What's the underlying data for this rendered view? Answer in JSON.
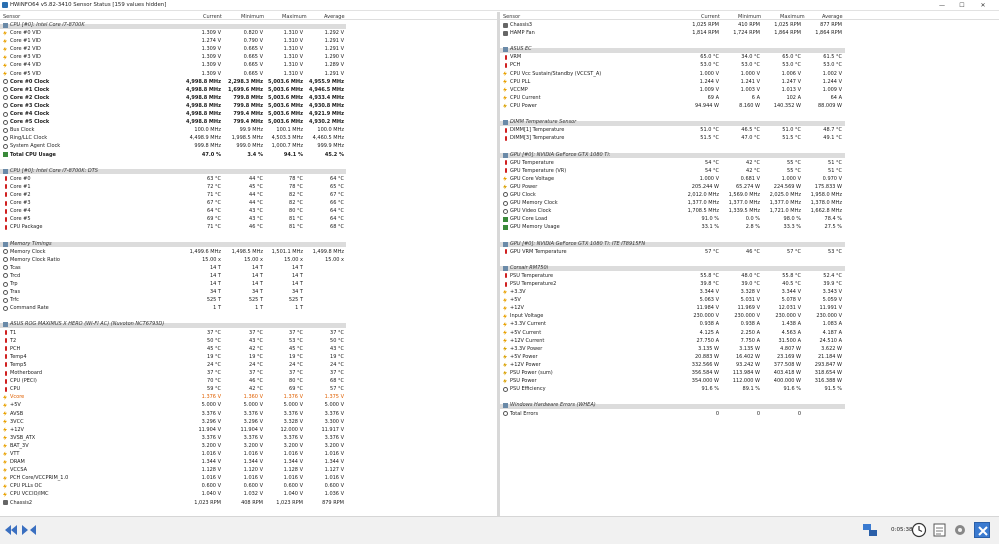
{
  "window": {
    "title": "HWiNFO64 v5.82-3410 Sensor Status [159 values hidden]",
    "minimize": "—",
    "maximize": "☐",
    "close": "✕"
  },
  "headers": {
    "sensor": "Sensor",
    "current": "Current",
    "minimum": "Minimum",
    "maximum": "Maximum",
    "average": "Average"
  },
  "left": [
    {
      "type": "group",
      "name": "CPU [#0]: Intel Core i7-8700K"
    },
    {
      "icon": "volt",
      "name": "Core #0 VID",
      "v": [
        "1.309 V",
        "0.820 V",
        "1.310 V",
        "1.292 V"
      ]
    },
    {
      "icon": "volt",
      "name": "Core #1 VID",
      "v": [
        "1.274 V",
        "0.790 V",
        "1.310 V",
        "1.291 V"
      ]
    },
    {
      "icon": "volt",
      "name": "Core #2 VID",
      "v": [
        "1.309 V",
        "0.665 V",
        "1.310 V",
        "1.291 V"
      ]
    },
    {
      "icon": "volt",
      "name": "Core #3 VID",
      "v": [
        "1.309 V",
        "0.665 V",
        "1.310 V",
        "1.290 V"
      ]
    },
    {
      "icon": "volt",
      "name": "Core #4 VID",
      "v": [
        "1.309 V",
        "0.665 V",
        "1.310 V",
        "1.289 V"
      ]
    },
    {
      "icon": "volt",
      "name": "Core #5 VID",
      "v": [
        "1.309 V",
        "0.665 V",
        "1.310 V",
        "1.291 V"
      ]
    },
    {
      "icon": "clock",
      "bold": true,
      "name": "Core #0 Clock",
      "v": [
        "4,998.8 MHz",
        "2,298.3 MHz",
        "5,003.6 MHz",
        "4,955.9 MHz"
      ]
    },
    {
      "icon": "clock",
      "bold": true,
      "name": "Core #1 Clock",
      "v": [
        "4,998.8 MHz",
        "1,699.6 MHz",
        "5,003.6 MHz",
        "4,946.5 MHz"
      ]
    },
    {
      "icon": "clock",
      "bold": true,
      "name": "Core #2 Clock",
      "v": [
        "4,998.8 MHz",
        "799.8 MHz",
        "5,003.6 MHz",
        "4,933.4 MHz"
      ]
    },
    {
      "icon": "clock",
      "bold": true,
      "name": "Core #3 Clock",
      "v": [
        "4,998.8 MHz",
        "799.8 MHz",
        "5,003.6 MHz",
        "4,930.8 MHz"
      ]
    },
    {
      "icon": "clock",
      "bold": true,
      "name": "Core #4 Clock",
      "v": [
        "4,998.8 MHz",
        "799.4 MHz",
        "5,003.6 MHz",
        "4,921.9 MHz"
      ]
    },
    {
      "icon": "clock",
      "bold": true,
      "name": "Core #5 Clock",
      "v": [
        "4,998.8 MHz",
        "799.4 MHz",
        "5,003.6 MHz",
        "4,930.2 MHz"
      ]
    },
    {
      "icon": "clock",
      "name": "Bus Clock",
      "v": [
        "100.0 MHz",
        "99.9 MHz",
        "100.1 MHz",
        "100.0 MHz"
      ]
    },
    {
      "icon": "clock",
      "name": "Ring/LLC Clock",
      "v": [
        "4,498.9 MHz",
        "1,998.5 MHz",
        "4,503.3 MHz",
        "4,460.5 MHz"
      ]
    },
    {
      "icon": "clock",
      "name": "System Agent Clock",
      "v": [
        "999.8 MHz",
        "999.0 MHz",
        "1,000.7 MHz",
        "999.9 MHz"
      ]
    },
    {
      "icon": "load",
      "bold": true,
      "name": "Total CPU Usage",
      "v": [
        "47.0 %",
        "3.4 %",
        "94.1 %",
        "45.2 %"
      ]
    },
    {
      "type": "gap"
    },
    {
      "type": "group",
      "name": "CPU [#0]: Intel Core i7-8700K: DTS"
    },
    {
      "icon": "temp",
      "name": "Core #0",
      "v": [
        "63 °C",
        "44 °C",
        "78 °C",
        "64 °C"
      ]
    },
    {
      "icon": "temp",
      "name": "Core #1",
      "v": [
        "72 °C",
        "45 °C",
        "78 °C",
        "65 °C"
      ]
    },
    {
      "icon": "temp",
      "name": "Core #2",
      "v": [
        "71 °C",
        "44 °C",
        "82 °C",
        "67 °C"
      ]
    },
    {
      "icon": "temp",
      "name": "Core #3",
      "v": [
        "67 °C",
        "44 °C",
        "82 °C",
        "66 °C"
      ]
    },
    {
      "icon": "temp",
      "name": "Core #4",
      "v": [
        "64 °C",
        "43 °C",
        "80 °C",
        "64 °C"
      ]
    },
    {
      "icon": "temp",
      "name": "Core #5",
      "v": [
        "69 °C",
        "43 °C",
        "81 °C",
        "64 °C"
      ]
    },
    {
      "icon": "temp",
      "name": "CPU Package",
      "v": [
        "71 °C",
        "46 °C",
        "81 °C",
        "68 °C"
      ]
    },
    {
      "type": "gap"
    },
    {
      "type": "group",
      "name": "Memory Timings"
    },
    {
      "icon": "clock",
      "name": "Memory Clock",
      "v": [
        "1,499.6 MHz",
        "1,498.5 MHz",
        "1,501.1 MHz",
        "1,499.8 MHz"
      ]
    },
    {
      "icon": "clock",
      "name": "Memory Clock Ratio",
      "v": [
        "15.00 x",
        "15.00 x",
        "15.00 x",
        "15.00 x"
      ]
    },
    {
      "icon": "clock",
      "name": "Tcas",
      "v": [
        "14 T",
        "14 T",
        "14 T",
        ""
      ]
    },
    {
      "icon": "clock",
      "name": "Trcd",
      "v": [
        "14 T",
        "14 T",
        "14 T",
        ""
      ]
    },
    {
      "icon": "clock",
      "name": "Trp",
      "v": [
        "14 T",
        "14 T",
        "14 T",
        ""
      ]
    },
    {
      "icon": "clock",
      "name": "Tras",
      "v": [
        "34 T",
        "34 T",
        "34 T",
        ""
      ]
    },
    {
      "icon": "clock",
      "name": "Trfc",
      "v": [
        "525 T",
        "525 T",
        "525 T",
        ""
      ]
    },
    {
      "icon": "clock",
      "name": "Command Rate",
      "v": [
        "1 T",
        "1 T",
        "1 T",
        ""
      ]
    },
    {
      "type": "gap"
    },
    {
      "type": "group",
      "name": "ASUS ROG MAXIMUS X HERO (WI-FI AC) (Nuvoton NCT6793D)"
    },
    {
      "icon": "temp",
      "name": "T1",
      "v": [
        "37 °C",
        "37 °C",
        "37 °C",
        "37 °C"
      ]
    },
    {
      "icon": "temp",
      "name": "T2",
      "v": [
        "50 °C",
        "43 °C",
        "53 °C",
        "50 °C"
      ]
    },
    {
      "icon": "temp",
      "name": "PCH",
      "v": [
        "45 °C",
        "42 °C",
        "45 °C",
        "43 °C"
      ]
    },
    {
      "icon": "temp",
      "name": "Temp4",
      "v": [
        "19 °C",
        "19 °C",
        "19 °C",
        "19 °C"
      ]
    },
    {
      "icon": "temp",
      "name": "Temp5",
      "v": [
        "24 °C",
        "24 °C",
        "24 °C",
        "24 °C"
      ]
    },
    {
      "icon": "temp",
      "name": "Motherboard",
      "v": [
        "37 °C",
        "37 °C",
        "37 °C",
        "37 °C"
      ]
    },
    {
      "icon": "temp",
      "name": "CPU (PECI)",
      "v": [
        "70 °C",
        "46 °C",
        "80 °C",
        "68 °C"
      ]
    },
    {
      "icon": "temp",
      "name": "CPU",
      "v": [
        "59 °C",
        "42 °C",
        "69 °C",
        "57 °C"
      ]
    },
    {
      "icon": "volt",
      "warn": true,
      "name": "Vcore",
      "v": [
        "1.376 V",
        "1.360 V",
        "1.376 V",
        "1.375 V"
      ]
    },
    {
      "icon": "volt",
      "name": "+5V",
      "v": [
        "5.000 V",
        "5.000 V",
        "5.000 V",
        "5.000 V"
      ]
    },
    {
      "icon": "volt",
      "name": "AVSB",
      "v": [
        "3.376 V",
        "3.376 V",
        "3.376 V",
        "3.376 V"
      ]
    },
    {
      "icon": "volt",
      "name": "3VCC",
      "v": [
        "3.296 V",
        "3.296 V",
        "3.328 V",
        "3.300 V"
      ]
    },
    {
      "icon": "volt",
      "name": "+12V",
      "v": [
        "11.904 V",
        "11.904 V",
        "12.000 V",
        "11.917 V"
      ]
    },
    {
      "icon": "volt",
      "name": "3VSB_ATX",
      "v": [
        "3.376 V",
        "3.376 V",
        "3.376 V",
        "3.376 V"
      ]
    },
    {
      "icon": "volt",
      "name": "BAT_3V",
      "v": [
        "3.200 V",
        "3.200 V",
        "3.200 V",
        "3.200 V"
      ]
    },
    {
      "icon": "volt",
      "name": "VTT",
      "v": [
        "1.016 V",
        "1.016 V",
        "1.016 V",
        "1.016 V"
      ]
    },
    {
      "icon": "volt",
      "name": "DRAM",
      "v": [
        "1.344 V",
        "1.344 V",
        "1.344 V",
        "1.344 V"
      ]
    },
    {
      "icon": "volt",
      "name": "VCCSA",
      "v": [
        "1.128 V",
        "1.120 V",
        "1.128 V",
        "1.127 V"
      ]
    },
    {
      "icon": "volt",
      "name": "PCH Core/VCCPRIM_1.0",
      "v": [
        "1.016 V",
        "1.016 V",
        "1.016 V",
        "1.016 V"
      ]
    },
    {
      "icon": "volt",
      "name": "CPU PLLs OC",
      "v": [
        "0.600 V",
        "0.600 V",
        "0.600 V",
        "0.600 V"
      ]
    },
    {
      "icon": "volt",
      "name": "CPU VCCIO/IMC",
      "v": [
        "1.040 V",
        "1.032 V",
        "1.040 V",
        "1.036 V"
      ]
    },
    {
      "icon": "fan",
      "name": "Chassis2",
      "v": [
        "1,023 RPM",
        "408 RPM",
        "1,023 RPM",
        "879 RPM"
      ]
    }
  ],
  "right": [
    {
      "icon": "fan",
      "name": "Chassis3",
      "v": [
        "1,025 RPM",
        "410 RPM",
        "1,025 RPM",
        "877 RPM"
      ]
    },
    {
      "icon": "fan",
      "name": "HAMP Fan",
      "v": [
        "1,814 RPM",
        "1,724 RPM",
        "1,864 RPM",
        "1,864 RPM"
      ]
    },
    {
      "type": "gap"
    },
    {
      "type": "group",
      "name": "ASUS EC"
    },
    {
      "icon": "temp",
      "name": "VRM",
      "v": [
        "65.0 °C",
        "34.0 °C",
        "65.0 °C",
        "61.5 °C"
      ]
    },
    {
      "icon": "temp",
      "name": "PCH",
      "v": [
        "53.0 °C",
        "53.0 °C",
        "53.0 °C",
        "53.0 °C"
      ]
    },
    {
      "icon": "volt",
      "name": "CPU Vcc Sustain/Standby (VCCST_A)",
      "v": [
        "1.000 V",
        "1.000 V",
        "1.006 V",
        "1.002 V"
      ]
    },
    {
      "icon": "volt",
      "name": "CPU PLL",
      "v": [
        "1.244 V",
        "1.241 V",
        "1.247 V",
        "1.244 V"
      ]
    },
    {
      "icon": "volt",
      "name": "VCCMP",
      "v": [
        "1.009 V",
        "1.003 V",
        "1.013 V",
        "1.009 V"
      ]
    },
    {
      "icon": "volt",
      "name": "CPU Current",
      "v": [
        "69 A",
        "6 A",
        "102 A",
        "64 A"
      ]
    },
    {
      "icon": "power",
      "name": "CPU Power",
      "v": [
        "94.944 W",
        "8.160 W",
        "140.352 W",
        "88.009 W"
      ]
    },
    {
      "type": "gap"
    },
    {
      "type": "group",
      "name": "DIMM Temperature Sensor"
    },
    {
      "icon": "temp",
      "name": "DIMM[1] Temperature",
      "v": [
        "51.0 °C",
        "46.5 °C",
        "51.0 °C",
        "48.7 °C"
      ]
    },
    {
      "icon": "temp",
      "name": "DIMM[3] Temperature",
      "v": [
        "51.5 °C",
        "47.0 °C",
        "51.5 °C",
        "49.1 °C"
      ]
    },
    {
      "type": "gap"
    },
    {
      "type": "group",
      "name": "GPU [#0]: NVIDIA GeForce GTX 1080 Ti:"
    },
    {
      "icon": "temp",
      "name": "GPU Temperature",
      "v": [
        "54 °C",
        "42 °C",
        "55 °C",
        "51 °C"
      ]
    },
    {
      "icon": "temp",
      "name": "GPU Temperature (VR)",
      "v": [
        "54 °C",
        "42 °C",
        "55 °C",
        "51 °C"
      ]
    },
    {
      "icon": "volt",
      "name": "GPU Core Voltage",
      "v": [
        "1.000 V",
        "0.681 V",
        "1.000 V",
        "0.970 V"
      ]
    },
    {
      "icon": "power",
      "name": "GPU Power",
      "v": [
        "205.244 W",
        "65.274 W",
        "224.569 W",
        "175.833 W"
      ]
    },
    {
      "icon": "clock",
      "name": "GPU Clock",
      "v": [
        "2,012.0 MHz",
        "1,569.0 MHz",
        "2,025.0 MHz",
        "1,958.0 MHz"
      ]
    },
    {
      "icon": "clock",
      "name": "GPU Memory Clock",
      "v": [
        "1,377.0 MHz",
        "1,377.0 MHz",
        "1,377.0 MHz",
        "1,378.0 MHz"
      ]
    },
    {
      "icon": "clock",
      "name": "GPU Video Clock",
      "v": [
        "1,708.5 MHz",
        "1,339.5 MHz",
        "1,721.0 MHz",
        "1,662.8 MHz"
      ]
    },
    {
      "icon": "load",
      "name": "GPU Core Load",
      "v": [
        "91.0 %",
        "0.0 %",
        "98.0 %",
        "78.4 %"
      ]
    },
    {
      "icon": "load",
      "name": "GPU Memory Usage",
      "v": [
        "33.1 %",
        "2.8 %",
        "33.3 %",
        "27.5 %"
      ]
    },
    {
      "type": "gap"
    },
    {
      "type": "group",
      "name": "GPU [#0]: NVIDIA GeForce GTX 1080 Ti: ITE IT8915FN"
    },
    {
      "icon": "temp",
      "name": "GPU VRM Temperature",
      "v": [
        "57 °C",
        "46 °C",
        "57 °C",
        "53 °C"
      ]
    },
    {
      "type": "gap"
    },
    {
      "type": "group",
      "name": "Corsair RM750i"
    },
    {
      "icon": "temp",
      "name": "PSU Temperature",
      "v": [
        "55.8 °C",
        "48.0 °C",
        "55.8 °C",
        "52.4 °C"
      ]
    },
    {
      "icon": "temp",
      "name": "PSU Temperature2",
      "v": [
        "39.8 °C",
        "39.0 °C",
        "40.5 °C",
        "39.9 °C"
      ]
    },
    {
      "icon": "volt",
      "name": "+3.3V",
      "v": [
        "3.344 V",
        "3.328 V",
        "3.344 V",
        "3.343 V"
      ]
    },
    {
      "icon": "volt",
      "name": "+5V",
      "v": [
        "5.063 V",
        "5.031 V",
        "5.078 V",
        "5.059 V"
      ]
    },
    {
      "icon": "volt",
      "name": "+12V",
      "v": [
        "11.984 V",
        "11.969 V",
        "12.031 V",
        "11.991 V"
      ]
    },
    {
      "icon": "volt",
      "name": "Input Voltage",
      "v": [
        "230.000 V",
        "230.000 V",
        "230.000 V",
        "230.000 V"
      ]
    },
    {
      "icon": "volt",
      "name": "+3.3V Current",
      "v": [
        "0.938 A",
        "0.938 A",
        "1.438 A",
        "1.083 A"
      ]
    },
    {
      "icon": "volt",
      "name": "+5V Current",
      "v": [
        "4.125 A",
        "2.250 A",
        "4.563 A",
        "4.187 A"
      ]
    },
    {
      "icon": "volt",
      "name": "+12V Current",
      "v": [
        "27.750 A",
        "7.750 A",
        "31.500 A",
        "24.510 A"
      ]
    },
    {
      "icon": "power",
      "name": "+3.3V Power",
      "v": [
        "3.135 W",
        "3.135 W",
        "4.807 W",
        "3.622 W"
      ]
    },
    {
      "icon": "power",
      "name": "+5V Power",
      "v": [
        "20.883 W",
        "16.402 W",
        "23.169 W",
        "21.184 W"
      ]
    },
    {
      "icon": "power",
      "name": "+12V Power",
      "v": [
        "332.566 W",
        "93.242 W",
        "377.508 W",
        "293.847 W"
      ]
    },
    {
      "icon": "power",
      "name": "PSU Power (sum)",
      "v": [
        "356.584 W",
        "113.984 W",
        "403.418 W",
        "318.654 W"
      ]
    },
    {
      "icon": "power",
      "name": "PSU Power",
      "v": [
        "354.000 W",
        "112.000 W",
        "400.000 W",
        "316.388 W"
      ]
    },
    {
      "icon": "err",
      "name": "PSU Efficiency",
      "v": [
        "91.6 %",
        "89.1 %",
        "91.6 %",
        "91.5 %"
      ]
    },
    {
      "type": "gap"
    },
    {
      "type": "group",
      "name": "Windows Hardware Errors (WHEA)"
    },
    {
      "icon": "err",
      "name": "Total Errors",
      "v": [
        "0",
        "0",
        "0",
        ""
      ]
    }
  ],
  "statusbar": {
    "timer": "0:05:38"
  }
}
